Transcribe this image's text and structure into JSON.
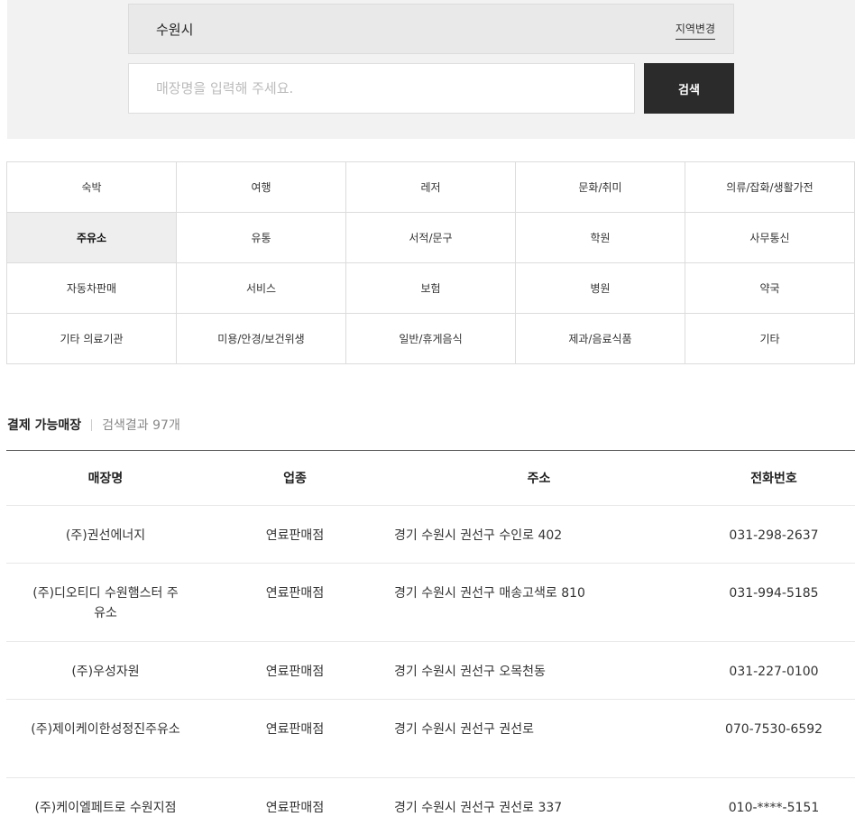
{
  "search": {
    "region": "수원시",
    "region_change_label": "지역변경",
    "placeholder": "매장명을 입력해 주세요.",
    "button_label": "검색"
  },
  "categories": [
    {
      "label": "숙박",
      "active": false
    },
    {
      "label": "여행",
      "active": false
    },
    {
      "label": "레저",
      "active": false
    },
    {
      "label": "문화/취미",
      "active": false
    },
    {
      "label": "의류/잡화/생활가전",
      "active": false
    },
    {
      "label": "주유소",
      "active": true
    },
    {
      "label": "유통",
      "active": false
    },
    {
      "label": "서적/문구",
      "active": false
    },
    {
      "label": "학원",
      "active": false
    },
    {
      "label": "사무통신",
      "active": false
    },
    {
      "label": "자동차판매",
      "active": false
    },
    {
      "label": "서비스",
      "active": false
    },
    {
      "label": "보험",
      "active": false
    },
    {
      "label": "병원",
      "active": false
    },
    {
      "label": "약국",
      "active": false
    },
    {
      "label": "기타 의료기관",
      "active": false
    },
    {
      "label": "미용/안경/보건위생",
      "active": false
    },
    {
      "label": "일반/휴게음식",
      "active": false
    },
    {
      "label": "제과/음료식품",
      "active": false
    },
    {
      "label": "기타",
      "active": false
    }
  ],
  "results": {
    "title": "결제 가능매장",
    "count_text": "검색결과 97개",
    "columns": [
      "매장명",
      "업종",
      "주소",
      "전화번호"
    ],
    "rows": [
      {
        "name": "(주)권선에너지",
        "type": "연료판매점",
        "address": "경기 수원시 권선구 수인로 402",
        "phone": "031-298-2637"
      },
      {
        "name": "(주)디오티디 수원햄스터 주유소",
        "type": "연료판매점",
        "address": "경기 수원시 권선구 매송고색로 810",
        "phone": "031-994-5185"
      },
      {
        "name": "(주)우성자원",
        "type": "연료판매점",
        "address": "경기 수원시 권선구 오목천동",
        "phone": "031-227-0100"
      },
      {
        "name": "(주)제이케이한성정진주유소",
        "type": "연료판매점",
        "address": "경기 수원시 권선구 권선로",
        "phone": "070-7530-6592"
      },
      {
        "name": "(주)케이엘페트로 수원지점",
        "type": "연료판매점",
        "address": "경기 수원시 권선구 권선로 337",
        "phone": "010-****-5151"
      }
    ]
  }
}
